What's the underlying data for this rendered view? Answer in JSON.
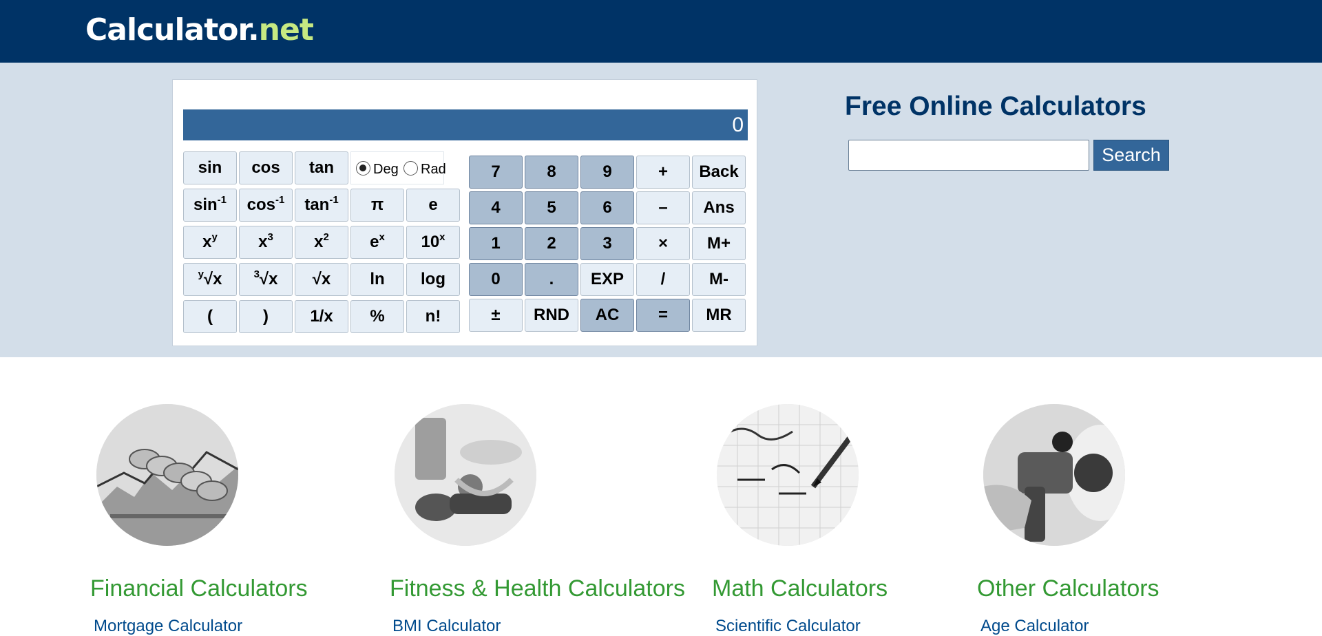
{
  "header": {
    "logo_main": "Calculator",
    "logo_dot": ".",
    "logo_tld": "net"
  },
  "calculator": {
    "display": "0",
    "angle_mode": {
      "deg_label": "Deg",
      "rad_label": "Rad",
      "selected": "Deg"
    },
    "sci_keys": {
      "sin": "sin",
      "cos": "cos",
      "tan": "tan",
      "asin_base": "sin",
      "asin_sup": "-1",
      "acos_base": "cos",
      "acos_sup": "-1",
      "atan_base": "tan",
      "atan_sup": "-1",
      "pi": "π",
      "e": "e",
      "xy_base": "x",
      "xy_sup": "y",
      "x3_base": "x",
      "x3_sup": "3",
      "x2_base": "x",
      "x2_sup": "2",
      "ex_base": "e",
      "ex_sup": "x",
      "tenx_base": "10",
      "tenx_sup": "x",
      "yroot_pre": "y",
      "yroot_body": "√x",
      "croot_pre": "3",
      "croot_body": "√x",
      "sqrt": "√x",
      "ln": "ln",
      "log": "log",
      "lparen": "(",
      "rparen": ")",
      "inv": "1/x",
      "percent": "%",
      "fact": "n!"
    },
    "num_keys": {
      "k7": "7",
      "k8": "8",
      "k9": "9",
      "plus": "+",
      "back": "Back",
      "k4": "4",
      "k5": "5",
      "k6": "6",
      "minus": "–",
      "ans": "Ans",
      "k1": "1",
      "k2": "2",
      "k3": "3",
      "times": "×",
      "mplus": "M+",
      "k0": "0",
      "dot": ".",
      "exp": "EXP",
      "divide": "/",
      "mminus": "M-",
      "plusminus": "±",
      "rnd": "RND",
      "ac": "AC",
      "equals": "=",
      "mr": "MR"
    }
  },
  "side": {
    "title": "Free Online Calculators",
    "search_value": "",
    "search_button": "Search"
  },
  "categories": [
    {
      "title": "Financial Calculators",
      "link": "Mortgage Calculator",
      "icon": "coins-image"
    },
    {
      "title": "Fitness & Health Calculators",
      "link": "BMI Calculator",
      "icon": "fitness-image"
    },
    {
      "title": "Math Calculators",
      "link": "Scientific Calculator",
      "icon": "math-image"
    },
    {
      "title": "Other Calculators",
      "link": "Age Calculator",
      "icon": "fuel-pump-image"
    }
  ],
  "colors": {
    "header_bg": "#003366",
    "band_bg": "#d3dee9",
    "display_bg": "#336699",
    "category_title": "#339933",
    "link": "#004a8c"
  }
}
